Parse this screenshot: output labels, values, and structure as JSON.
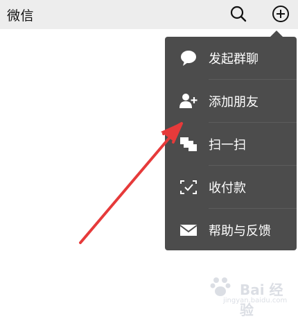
{
  "header": {
    "title": "微信",
    "search_icon": "search-icon",
    "add_icon": "plus-circle-icon"
  },
  "menu": {
    "items": [
      {
        "label": "发起群聊",
        "icon": "chat-bubble-icon"
      },
      {
        "label": "添加朋友",
        "icon": "add-friend-icon"
      },
      {
        "label": "扫一扫",
        "icon": "scan-icon"
      },
      {
        "label": "收付款",
        "icon": "payment-icon"
      },
      {
        "label": "帮助与反馈",
        "icon": "mail-icon"
      }
    ]
  },
  "annotation": {
    "arrow_color": "#e63a3a"
  },
  "watermark": {
    "text": "Bai 经验",
    "sub": "jingyan.baidu.com"
  },
  "colors": {
    "menu_bg": "#4c4c4c",
    "header_bg": "#ededed"
  }
}
